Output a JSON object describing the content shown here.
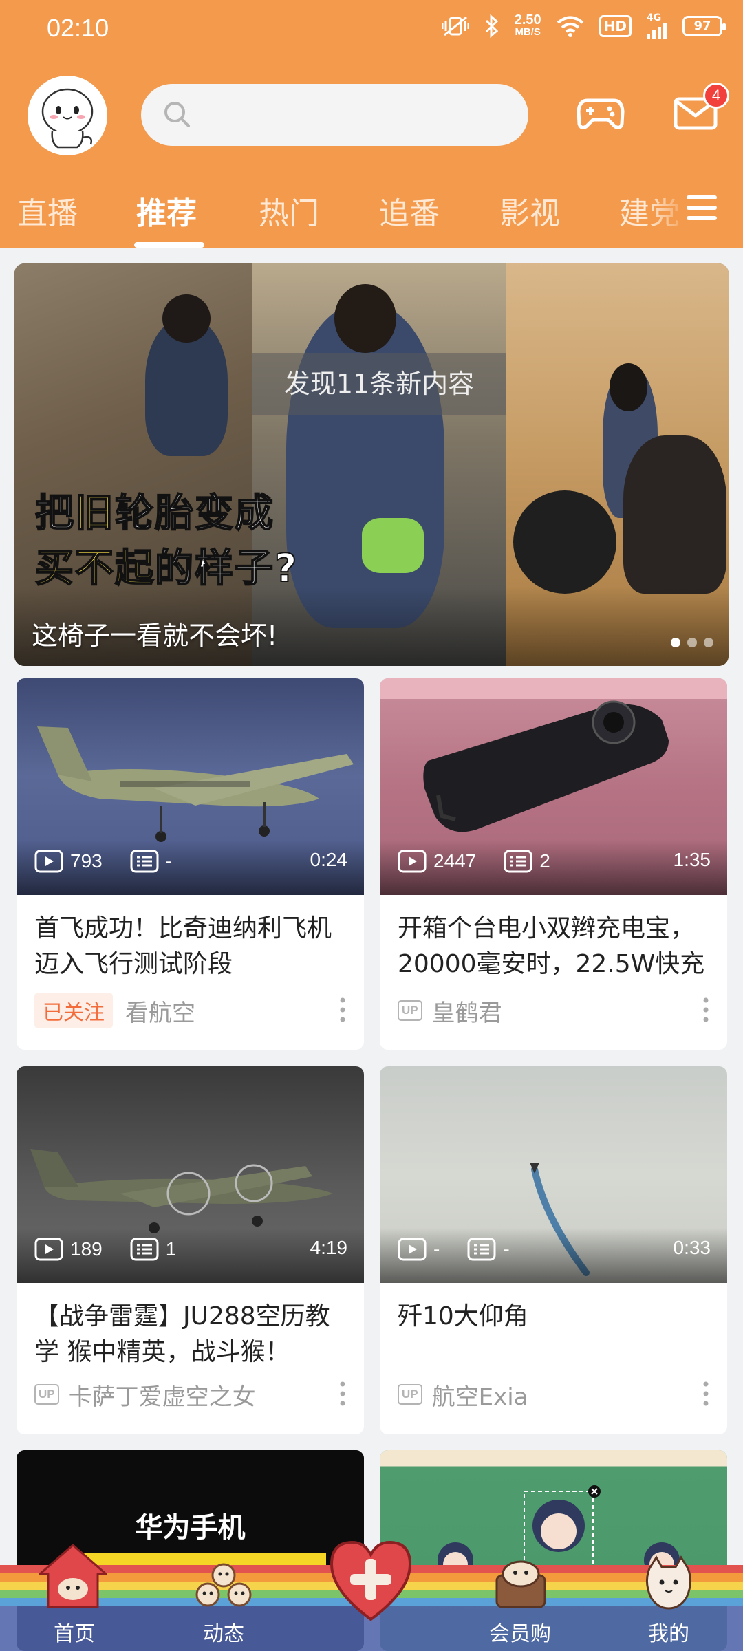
{
  "status_bar": {
    "time": "02:10",
    "net_speed_value": "2.50",
    "net_speed_unit": "MB/S",
    "hd": "HD",
    "signal": "4G",
    "battery": "97"
  },
  "header": {
    "search_placeholder": "",
    "mail_badge": "4"
  },
  "tabs": [
    "直播",
    "推荐",
    "热门",
    "追番",
    "影视",
    "建党"
  ],
  "active_tab": "推荐",
  "banner": {
    "toast": "发现11条新内容",
    "headline_1a": "把",
    "headline_1b": "旧",
    "headline_1c": "轮胎",
    "headline_1d": "变成",
    "headline_2a": "买不起",
    "headline_2b": "的样子?",
    "caption": "这椅子一看就不会坏!",
    "slides": 3,
    "active_slide": 1
  },
  "cards": [
    {
      "views": "793",
      "danmaku": "-",
      "duration": "0:24",
      "title": "首飞成功！比奇迪纳利飞机迈入飞行测试阶段",
      "followed_label": "已关注",
      "author": "看航空"
    },
    {
      "views": "2447",
      "danmaku": "2",
      "duration": "1:35",
      "title": "开箱个台电小双辫充电宝，20000毫安时，22.5W快充",
      "up_label": "UP",
      "author": "皇鹤君"
    },
    {
      "views": "189",
      "danmaku": "1",
      "duration": "4:19",
      "title": "【战争雷霆】JU288空历教学 猴中精英，战斗猴！",
      "up_label": "UP",
      "author": "卡萨丁爱虚空之女"
    },
    {
      "views": "-",
      "danmaku": "-",
      "duration": "0:33",
      "title": "歼10大仰角",
      "up_label": "UP",
      "author": "航空Exia"
    },
    {
      "thumb_text": "华为手机"
    }
  ],
  "bottom_nav": {
    "items": [
      "首页",
      "动态",
      "",
      "会员购",
      "我的"
    ]
  },
  "colors": {
    "header": "#f39a4d",
    "accent": "#f36d3c",
    "badge": "#f2403c"
  }
}
